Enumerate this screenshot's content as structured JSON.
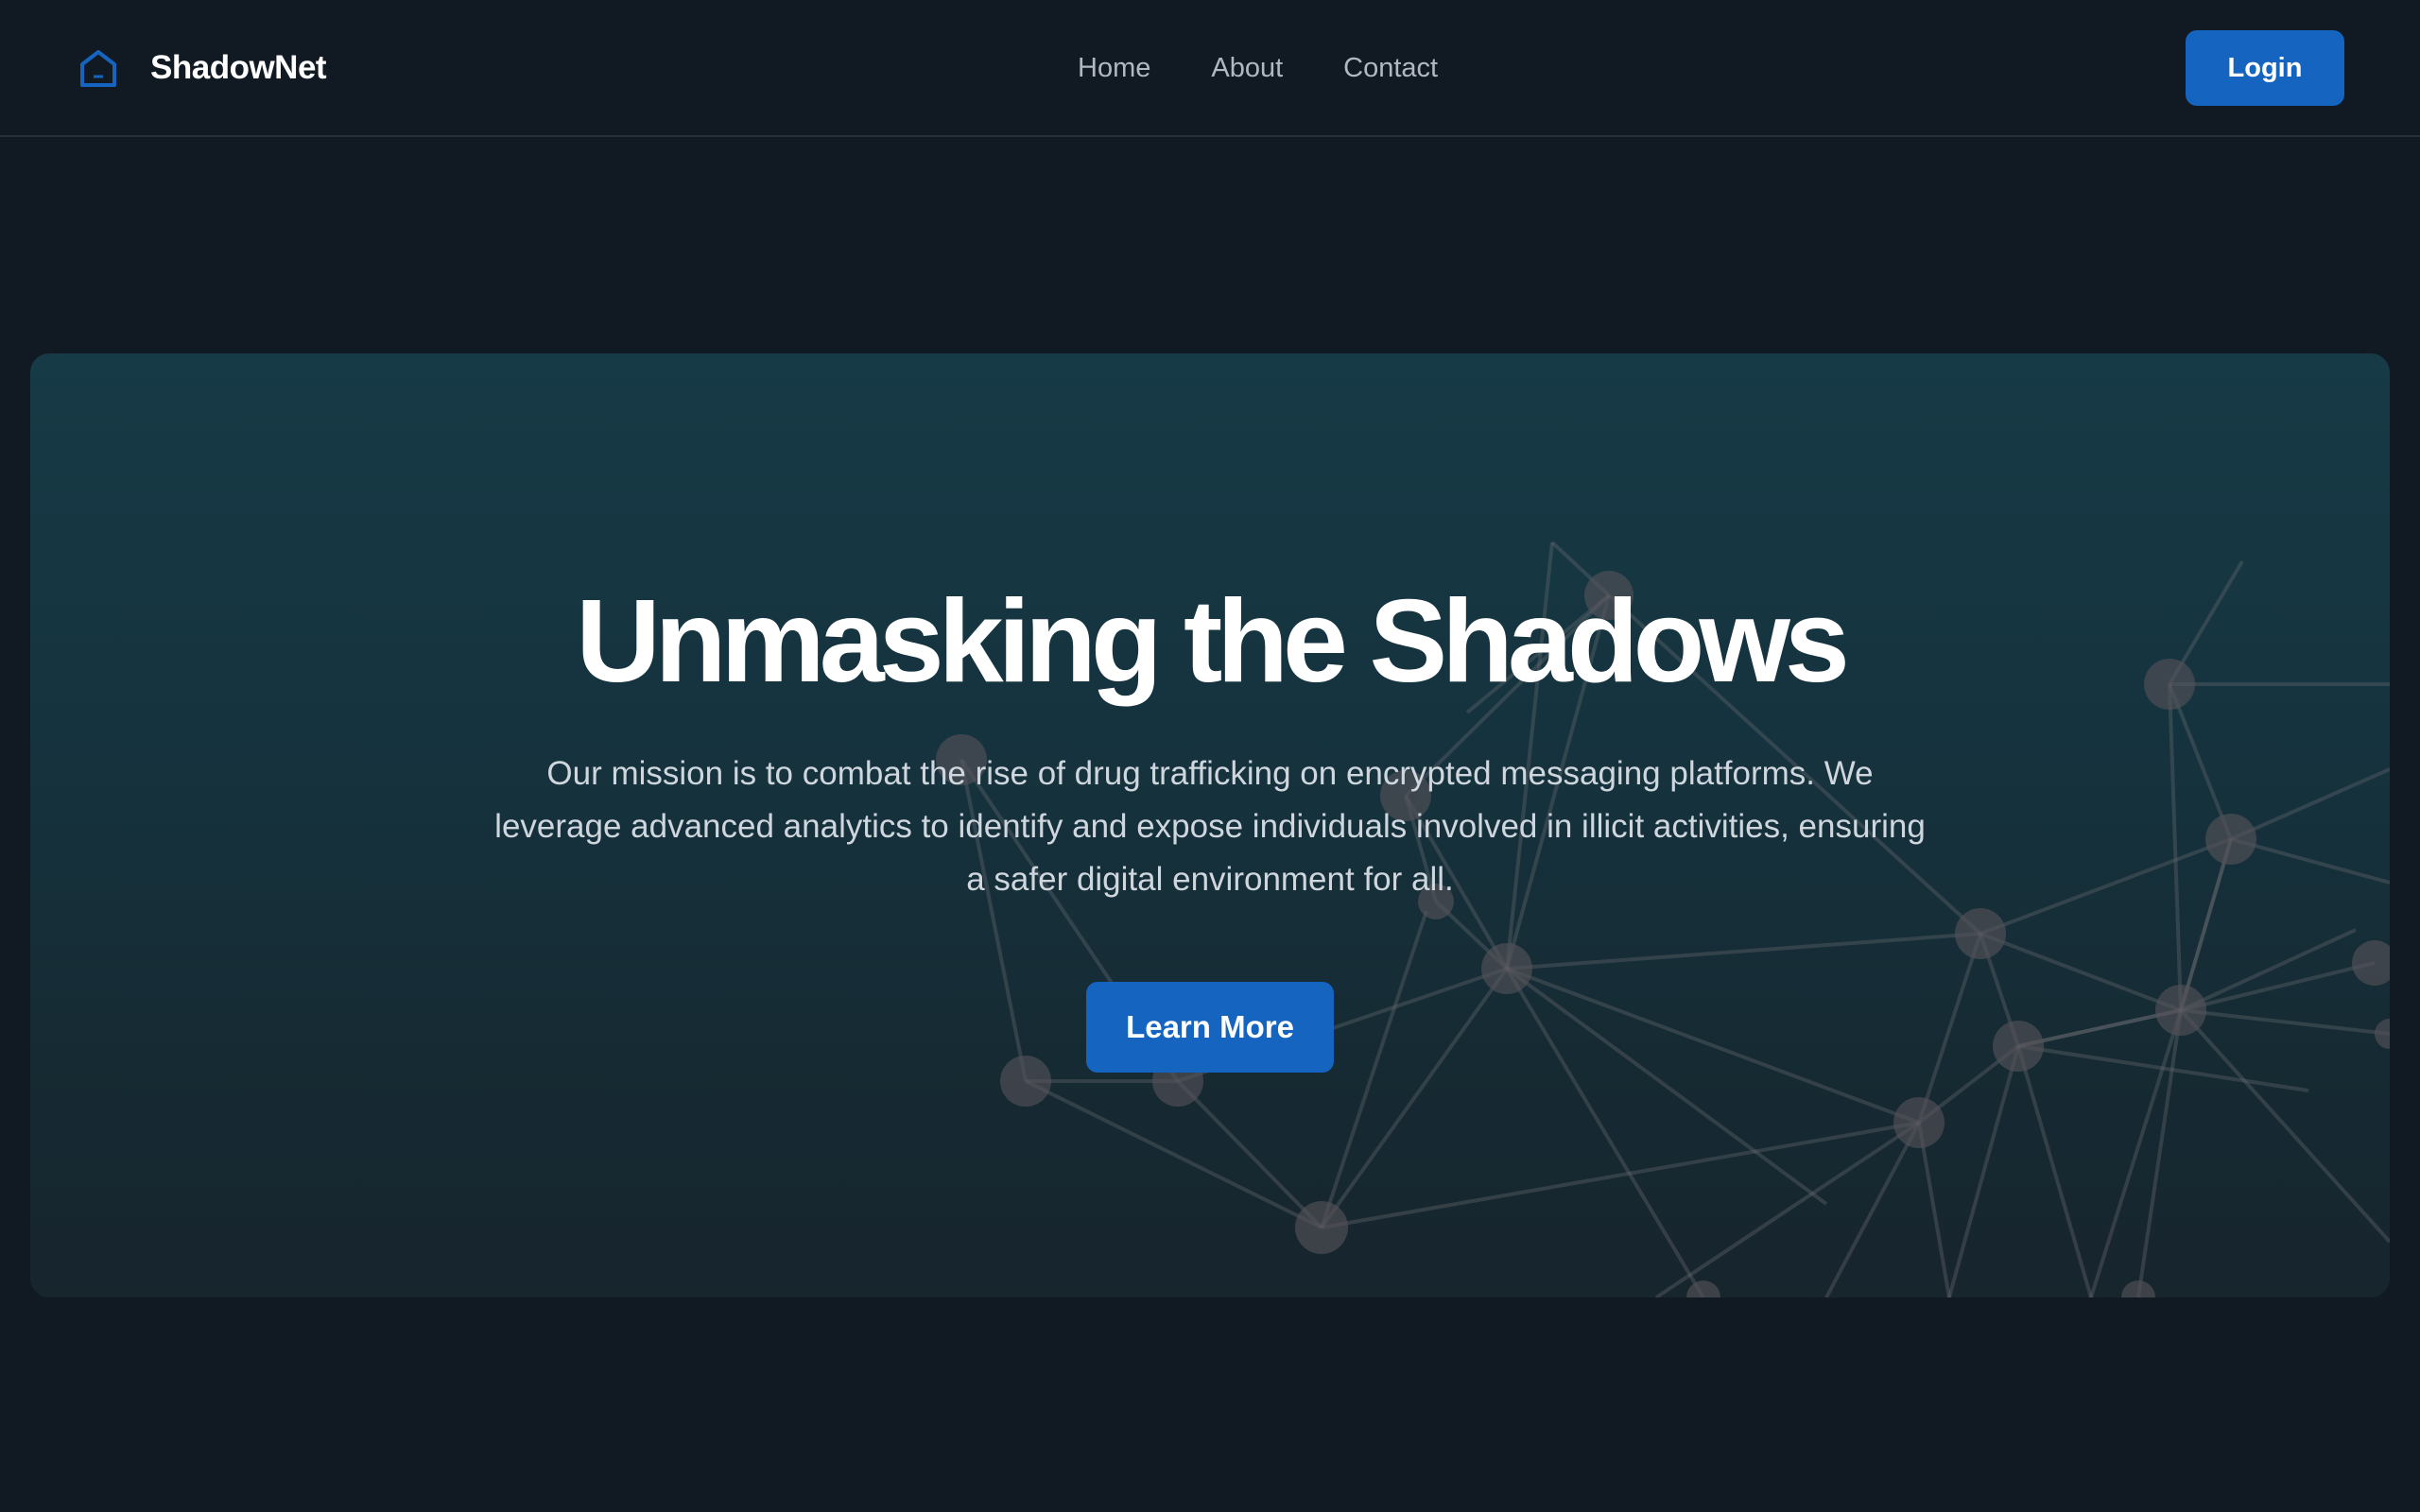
{
  "header": {
    "brand_name": "ShadowNet",
    "brand_icon": "home-icon",
    "nav": [
      "Home",
      "About",
      "Contact"
    ],
    "login_label": "Login"
  },
  "hero": {
    "title": "Unmasking the Shadows",
    "description": "Our mission is to combat the rise of drug trafficking on encrypted messaging platforms. We leverage advanced analytics to identify and expose individuals involved in illicit activities, ensuring a safer digital environment for all.",
    "cta_label": "Learn More",
    "background_graphic": "network-graph"
  },
  "colors": {
    "page_bg": "#111923",
    "accent": "#1565c0",
    "hero_bg_top": "#163a46",
    "hero_bg_bottom": "#17252d",
    "nav_text": "#b2b8c2",
    "heading_text": "#ffffff"
  }
}
